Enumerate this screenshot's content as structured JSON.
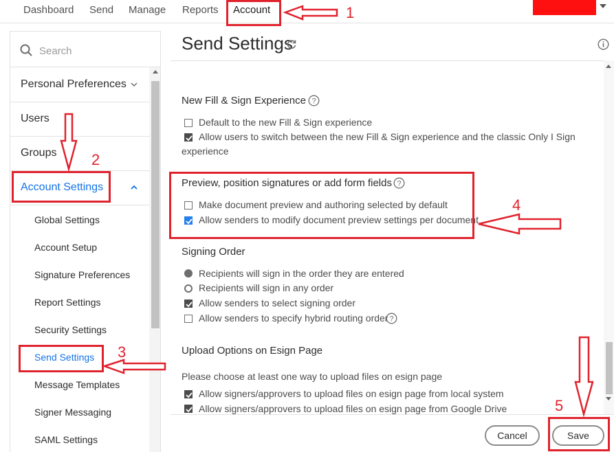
{
  "nav": {
    "items": [
      "Dashboard",
      "Send",
      "Manage",
      "Reports",
      "Account"
    ],
    "active": "Account"
  },
  "sidebar": {
    "search_placeholder": "Search",
    "items": [
      "Personal Preferences",
      "Users",
      "Groups",
      "Account Settings"
    ],
    "subitems": [
      "Global Settings",
      "Account Setup",
      "Signature Preferences",
      "Report Settings",
      "Security Settings",
      "Send Settings",
      "Message Templates",
      "Signer Messaging",
      "SAML Settings"
    ],
    "active_subitem": "Send Settings"
  },
  "page": {
    "title": "Send Settings"
  },
  "sections": {
    "fillsign": {
      "title": "New Fill & Sign Experience",
      "opt1": "Default to the new Fill & Sign experience",
      "opt2_line1": "Allow users to switch between the new Fill & Sign experience and the classic Only I Sign",
      "opt2_line2": "experience",
      "opt1_checked": false,
      "opt2_checked": true
    },
    "preview": {
      "title": "Preview, position signatures or add form fields",
      "opt1": "Make document preview and authoring selected by default",
      "opt2": "Allow senders to modify document preview settings per document",
      "opt1_checked": false,
      "opt2_checked": true
    },
    "signing_order": {
      "title": "Signing Order",
      "radio1": "Recipients will sign in the order they are entered",
      "radio2": "Recipients will sign in any order",
      "cb1": "Allow senders to select signing order",
      "cb2": "Allow senders to specify hybrid routing order",
      "selected_radio": 1,
      "cb1_checked": true,
      "cb2_checked": false
    },
    "upload": {
      "title": "Upload Options on Esign Page",
      "description": "Please choose at least one way to upload files on esign page",
      "opt1": "Allow signers/approvers to upload files on esign page from local system",
      "opt2": "Allow signers/approvers to upload files on esign page from Google Drive",
      "opt1_checked": true,
      "opt2_checked": true
    }
  },
  "footer": {
    "cancel": "Cancel",
    "save": "Save"
  },
  "annotations": {
    "n1": "1",
    "n2": "2",
    "n3": "3",
    "n4": "4",
    "n5": "5"
  },
  "colors": {
    "annotation": "#e0222d",
    "accent": "#1473e6",
    "redaction": "#ff1010"
  }
}
